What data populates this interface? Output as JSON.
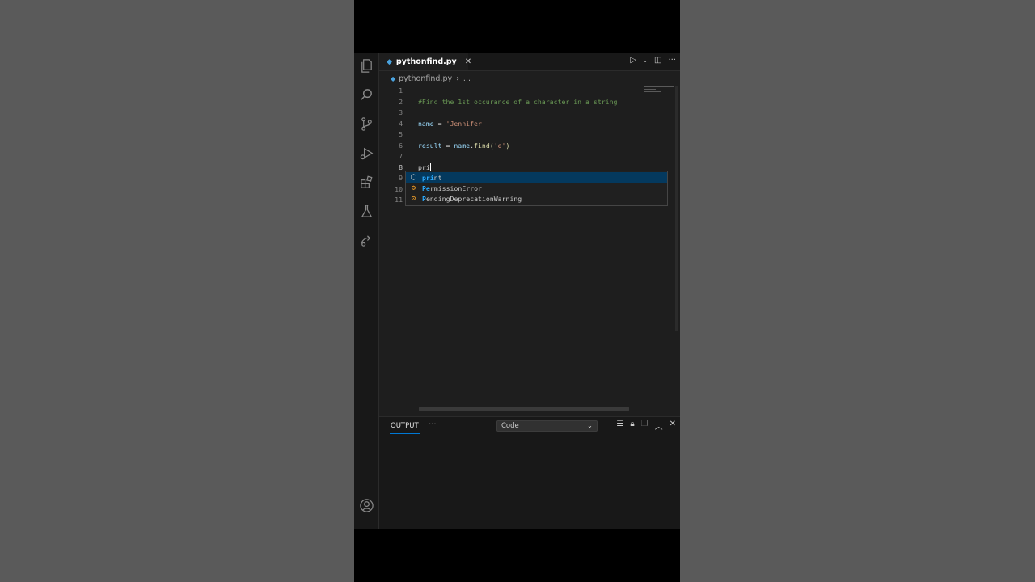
{
  "editor": {
    "tab_name": "pythonfind.py",
    "breadcrumb_file": "pythonfind.py",
    "breadcrumb_more": "...",
    "line_numbers": [
      "1",
      "2",
      "3",
      "4",
      "5",
      "6",
      "7",
      "8",
      "9",
      "10",
      "11"
    ],
    "line2_comment": "#Find the 1st occurance of a character in a string",
    "line4_var": "name",
    "line4_op": " = ",
    "line4_str": "'Jennifer'",
    "line6_var": "result",
    "line6_op": " = ",
    "line6_obj": "name",
    "line6_dot": ".",
    "line6_fn": "find",
    "line6_open": "(",
    "line6_arg": "'e'",
    "line6_close": ")",
    "line8_typed": "pri"
  },
  "suggestions": [
    {
      "match": "pri",
      "rest": "nt",
      "icon": "cube-icon"
    },
    {
      "match": "Pe",
      "mid": "rmission",
      "rest": "Error",
      "icon": "class-icon"
    },
    {
      "match": "P",
      "rest": "endingDeprecationWarning",
      "icon": "class-icon"
    }
  ],
  "panel": {
    "tab_output": "OUTPUT",
    "more": "···",
    "channel": "Code"
  },
  "colors": {
    "accent": "#0078d4",
    "comment": "#6a9955",
    "string": "#ce9178",
    "variable": "#9cdcfe",
    "function": "#dcdcaa"
  }
}
